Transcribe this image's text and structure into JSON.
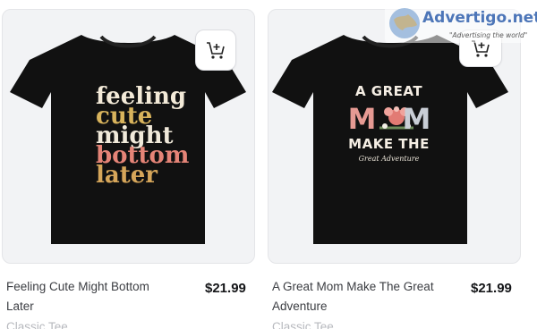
{
  "products": [
    {
      "title": "Feeling Cute Might Bottom Later",
      "title_line1": "Feeling Cute Might Bottom",
      "title_line2": "Later",
      "price": "$21.99",
      "subtitle": "Classic Tee",
      "design_lines": [
        "feeling",
        "cute",
        "might",
        "bottom",
        "later"
      ],
      "shirt_color": "#111111"
    },
    {
      "title": "A Great Mom Make The Great Adventure",
      "title_line1": "A Great Mom Make The Great",
      "title_line2": "Adventure",
      "price": "$21.99",
      "subtitle": "Classic Tee",
      "design": {
        "top": "A GREAT",
        "mid_m1": "M",
        "mid_m2": "M",
        "bottom": "MAKE THE",
        "script": "Great Adventure"
      },
      "shirt_color": "#111111"
    }
  ],
  "cart_icon": "add-to-cart-icon",
  "watermark": {
    "brand": "Advertigo.net",
    "tagline": "\"Advertising the world\"",
    "brand_color": "#4d76b8"
  },
  "colors": {
    "card_bg": "#f2f3f5",
    "title": "#3b3d42",
    "price": "#141518",
    "subtitle": "#b7b9be"
  }
}
